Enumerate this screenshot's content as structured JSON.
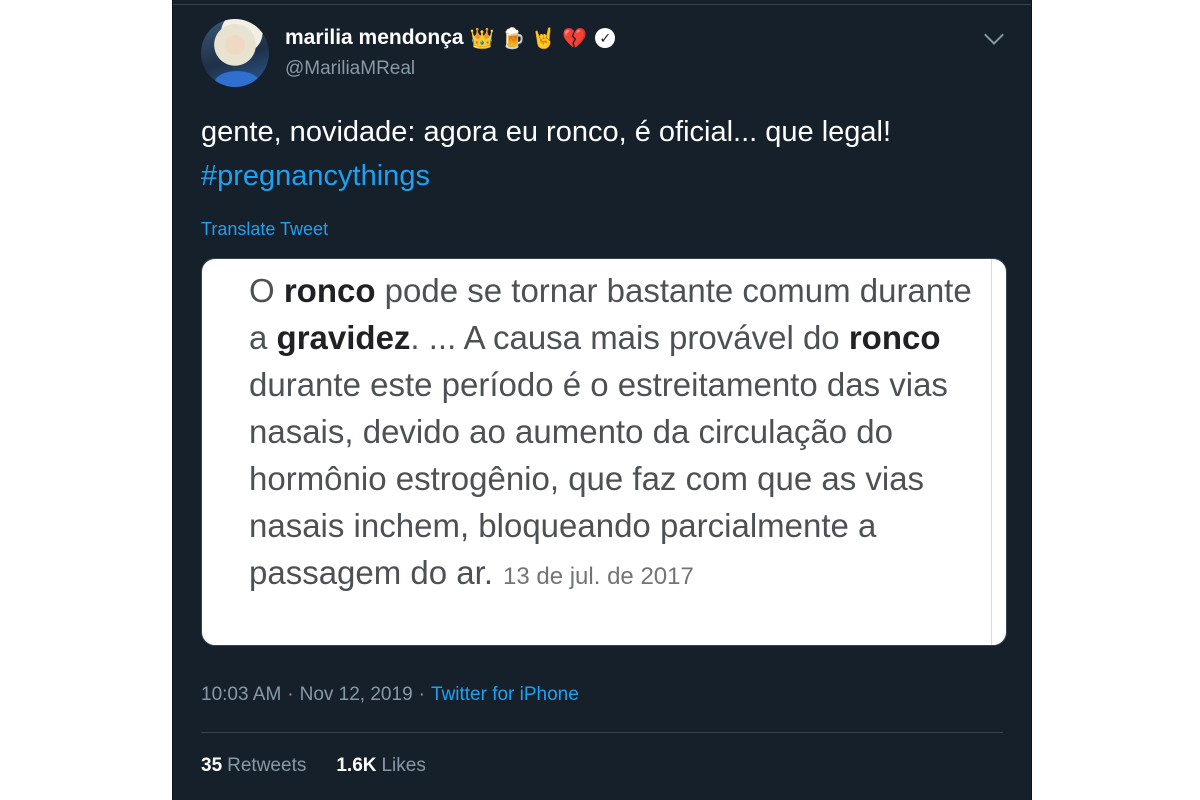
{
  "tweet": {
    "display_name": "marilia mendonça",
    "badges": [
      "👑",
      "🍺",
      "🤘",
      "💔"
    ],
    "verified_icon": "✓",
    "handle": "@MariliaMReal",
    "text": "gente, novidade: agora eu ronco, é oficial... que legal!",
    "hashtag": "#pregnancythings",
    "translate_label": "Translate Tweet",
    "timestamp": "10:03 AM",
    "separator": "·",
    "date": "Nov 12, 2019",
    "source": "Twitter for iPhone",
    "retweets_count": "35",
    "retweets_label": "Retweets",
    "likes_count": "1.6K",
    "likes_label": "Likes"
  },
  "media": {
    "segments": [
      "O ",
      "ronco",
      " pode se tornar bastante comum durante a ",
      "gravidez",
      ". ... A causa mais provável do ",
      "ronco",
      " durante este período é o estreitamento das vias nasais, devido ao aumento da circulação do hormônio estrogênio, que faz com que as vias nasais inchem, bloqueando parcialmente a passagem do ar."
    ],
    "date": "13 de jul. de 2017"
  },
  "colors": {
    "background": "#15202b",
    "accent": "#1da1f2",
    "secondary_text": "#8899a6",
    "divider": "#38444d"
  }
}
